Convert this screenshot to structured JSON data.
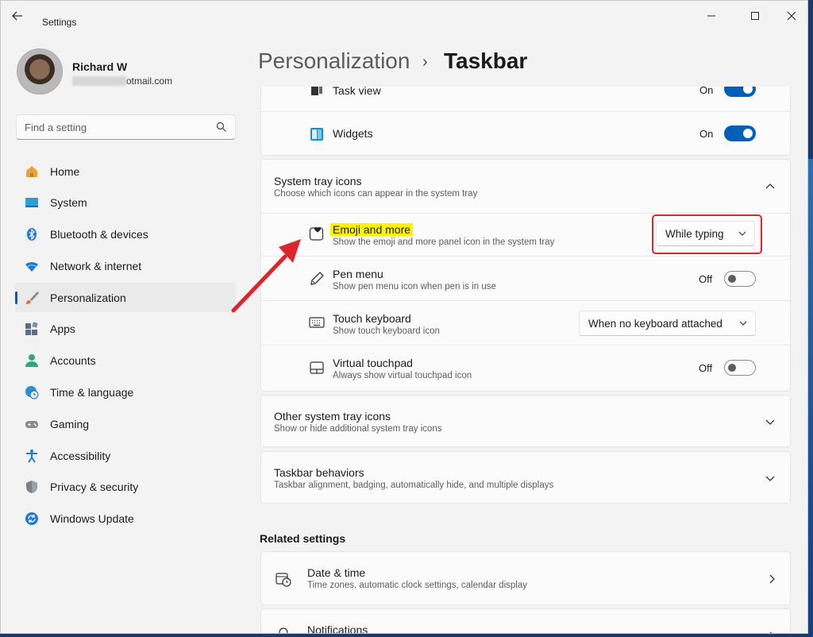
{
  "window": {
    "app_title": "Settings",
    "back_icon": "back-arrow-icon",
    "controls": [
      "minimize-icon",
      "maximize-icon",
      "close-icon"
    ]
  },
  "profile": {
    "name": "Richard W",
    "email_visible": "otmail.com"
  },
  "search": {
    "placeholder": "Find a setting"
  },
  "nav": {
    "items": [
      {
        "label": "Home",
        "icon": "home-icon"
      },
      {
        "label": "System",
        "icon": "monitor-icon"
      },
      {
        "label": "Bluetooth & devices",
        "icon": "bluetooth-icon"
      },
      {
        "label": "Network & internet",
        "icon": "wifi-icon"
      },
      {
        "label": "Personalization",
        "icon": "brush-icon",
        "active": true
      },
      {
        "label": "Apps",
        "icon": "apps-icon"
      },
      {
        "label": "Accounts",
        "icon": "person-icon"
      },
      {
        "label": "Time & language",
        "icon": "globe-clock-icon"
      },
      {
        "label": "Gaming",
        "icon": "gamepad-icon"
      },
      {
        "label": "Accessibility",
        "icon": "accessibility-icon"
      },
      {
        "label": "Privacy & security",
        "icon": "shield-icon"
      },
      {
        "label": "Windows Update",
        "icon": "update-icon"
      }
    ]
  },
  "header": {
    "parent": "Personalization",
    "separator": "›",
    "current": "Taskbar"
  },
  "taskbar_items": {
    "task_view": {
      "label": "Task view",
      "state": "On"
    },
    "widgets": {
      "label": "Widgets",
      "state": "On"
    }
  },
  "system_tray": {
    "title": "System tray icons",
    "subtitle": "Choose which icons can appear in the system tray",
    "rows": {
      "emoji": {
        "title": "Emoji and more",
        "subtitle": "Show the emoji and more panel icon in the system tray",
        "value": "While typing"
      },
      "pen": {
        "title": "Pen menu",
        "subtitle": "Show pen menu icon when pen is in use",
        "state": "Off"
      },
      "touch_keyboard": {
        "title": "Touch keyboard",
        "subtitle": "Show touch keyboard icon",
        "value": "When no keyboard attached"
      },
      "virtual_touchpad": {
        "title": "Virtual touchpad",
        "subtitle": "Always show virtual touchpad icon",
        "state": "Off"
      }
    }
  },
  "other_tray": {
    "title": "Other system tray icons",
    "subtitle": "Show or hide additional system tray icons"
  },
  "behaviors": {
    "title": "Taskbar behaviors",
    "subtitle": "Taskbar alignment, badging, automatically hide, and multiple displays"
  },
  "related": {
    "heading": "Related settings",
    "date_time": {
      "title": "Date & time",
      "subtitle": "Time zones, automatic clock settings, calendar display"
    },
    "notifications": {
      "title": "Notifications"
    }
  },
  "colors": {
    "accent": "#005fb8",
    "annotation_red": "#e0242b",
    "highlight_yellow": "#fff200"
  }
}
